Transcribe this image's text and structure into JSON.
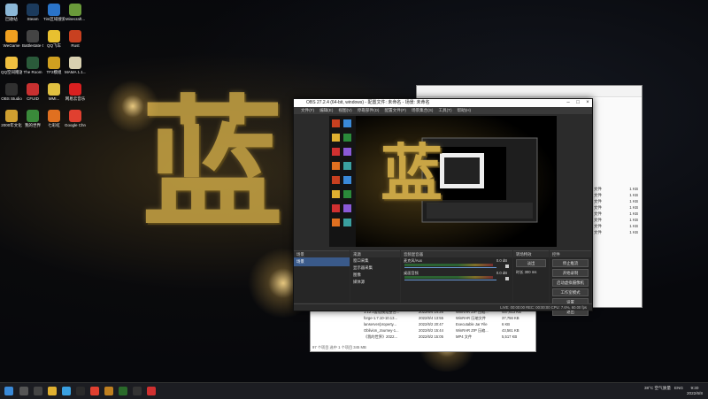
{
  "desktop": {
    "icons": [
      {
        "label": "回收站",
        "color": "#8cb8d8"
      },
      {
        "label": "Steam",
        "color": "#1b3a5c"
      },
      {
        "label": "Tim区域搜索",
        "color": "#2a74c9"
      },
      {
        "label": "Minecraft...",
        "color": "#6a9a3a"
      },
      {
        "label": "WeGame",
        "color": "#f0a020"
      },
      {
        "label": "Battlestate Games L...",
        "color": "#444"
      },
      {
        "label": "QQ飞车",
        "color": "#e8c030"
      },
      {
        "label": "Rust",
        "color": "#c84020"
      },
      {
        "label": "QQ空间赠送工具",
        "color": "#f0c040"
      },
      {
        "label": "The Room",
        "color": "#2a5a3a"
      },
      {
        "label": "TF2模组",
        "color": "#d0a020"
      },
      {
        "label": "MAMA 1.1...",
        "color": "#d8d0b0"
      },
      {
        "label": "OBS Studio",
        "color": "#303030"
      },
      {
        "label": "CFUID",
        "color": "#c83030"
      },
      {
        "label": "MMI...",
        "color": "#e0c040"
      },
      {
        "label": "网易云音乐",
        "color": "#d82020"
      },
      {
        "label": "2000年文化",
        "color": "#d0a030"
      },
      {
        "label": "我的世界",
        "color": "#3a8a3a"
      },
      {
        "label": "七彩虹",
        "color": "#e07020"
      },
      {
        "label": "Google Chrome",
        "color": "#e04030"
      }
    ]
  },
  "explorer": {
    "rows": [
      {
        "name": "文件",
        "size": "1 KB"
      },
      {
        "name": "文件",
        "size": "1 KB"
      },
      {
        "name": "文件",
        "size": "1 KB"
      },
      {
        "name": "文件",
        "size": "1 KB"
      },
      {
        "name": "文件",
        "size": "1 KB"
      },
      {
        "name": "文件",
        "size": "1 KB"
      },
      {
        "name": "文件",
        "size": "1 KB"
      },
      {
        "name": "文件",
        "size": "1 KB"
      }
    ],
    "lower_files": [
      {
        "name": "1.12.2要饭模组整合...",
        "date": "2022/6/4 14:26",
        "type": "WinRAR ZIP 压缩...",
        "size": "457,613 KB"
      },
      {
        "name": "forge-1.7.10-10.13...",
        "date": "2022/6/4 13:55",
        "type": "WinRAR 压缩文件",
        "size": "37,756 KB"
      },
      {
        "name": "lanserver/property...",
        "date": "2022/6/2 20:47",
        "type": "Executable Jar File",
        "size": "6 KB"
      },
      {
        "name": "Oblivion_Journey-1...",
        "date": "2022/6/2 15:44",
        "type": "WinRAR ZIP 压缩...",
        "size": "43,561 KB"
      },
      {
        "name": "《我的世界》2022...",
        "date": "2022/6/2 15:05",
        "type": "MP4 文件",
        "size": "5,517 KB"
      }
    ],
    "status": "97 个项目   选中 1 个项目 345 MB"
  },
  "obs": {
    "title": "OBS 27.2.4 (64-bit, windows) - 配置文件: 未命名 - 场景: 未命名",
    "menu": [
      "文件(F)",
      "编辑(E)",
      "视图(V)",
      "停靠部件(D)",
      "配置文件(P)",
      "场景集合(S)",
      "工具(T)",
      "帮助(H)"
    ],
    "panels": {
      "scenes": "场景",
      "sources": "来源",
      "mixer": "音频混音器",
      "transitions": "转场特效",
      "controls": "控件"
    },
    "scene_item": "场景",
    "source_items": [
      "窗口采集",
      "显示器采集",
      "图像",
      "媒体源"
    ],
    "mixer_channels": [
      {
        "name": "麦克风/Aux",
        "db": "0.0 dB"
      },
      {
        "name": "桌面音频",
        "db": "0.0 dB"
      }
    ],
    "transition": {
      "type": "淡出",
      "duration_label": "时长",
      "duration": "300 ms"
    },
    "controls": [
      "停止推流",
      "开始录制",
      "启动虚拟摄像机",
      "工作室模式",
      "设置",
      "退出"
    ],
    "status": "LIVE: 00:00:00   REC: 00:00:00   CPU: 7.6%, 60.00 fps"
  },
  "preview_overlay_text": "蓝",
  "taskbar": {
    "time": "9:30",
    "date": "2022/6/8",
    "lang": "ENG",
    "network": "38°C 空气质量"
  },
  "colors": {
    "desktop_bg": "#07080c",
    "gold": "#c9a545",
    "obs_bg": "#2b2b2b",
    "taskbar": "#1c1d22"
  }
}
